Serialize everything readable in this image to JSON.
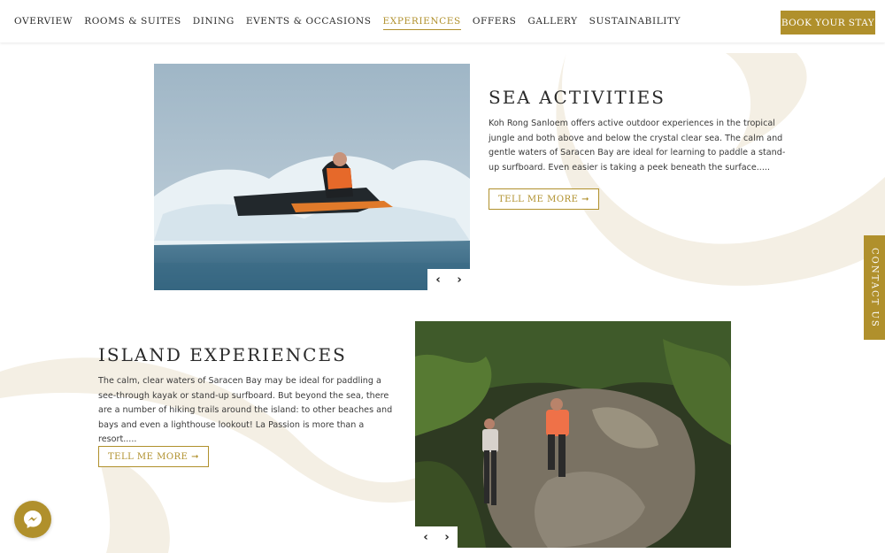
{
  "nav": {
    "items": [
      {
        "label": "OVERVIEW",
        "active": false
      },
      {
        "label": "ROOMS & SUITES",
        "active": false
      },
      {
        "label": "DINING",
        "active": false
      },
      {
        "label": "EVENTS & OCCASIONS",
        "active": false
      },
      {
        "label": "EXPERIENCES",
        "active": true
      },
      {
        "label": "OFFERS",
        "active": false
      },
      {
        "label": "GALLERY",
        "active": false
      },
      {
        "label": "SUSTAINABILITY",
        "active": false
      }
    ],
    "book_label": "BOOK YOUR STAY"
  },
  "sections": [
    {
      "title": "SEA ACTIVITIES",
      "body": "Koh Rong Sanloem offers active outdoor experiences in the tropical jungle and both above and below the crystal clear sea. The calm and gentle waters of Saracen Bay are ideal for learning to paddle a stand-up surfboard. Even easier is taking a peek beneath the surface.....",
      "button_label": "TELL ME MORE ➞",
      "photo": "jet-ski-photo"
    },
    {
      "title": "ISLAND EXPERIENCES",
      "body": "The calm, clear waters of Saracen Bay may be ideal for paddling a see-through kayak or stand-up surfboard. But beyond the sea, there are a number of hiking trails around the island: to other beaches and bays and even a lighthouse lookout! La Passion is more than a resort.....",
      "button_label": "TELL ME MORE ➞",
      "photo": "jungle-hiking-photo"
    }
  ],
  "carousel": {
    "prev": "‹",
    "next": "›"
  },
  "contact_tab": "CONTACT US",
  "icons": {
    "messenger": "messenger-icon"
  },
  "colors": {
    "accent": "#b0902c",
    "swirl": "#f4efe4"
  }
}
